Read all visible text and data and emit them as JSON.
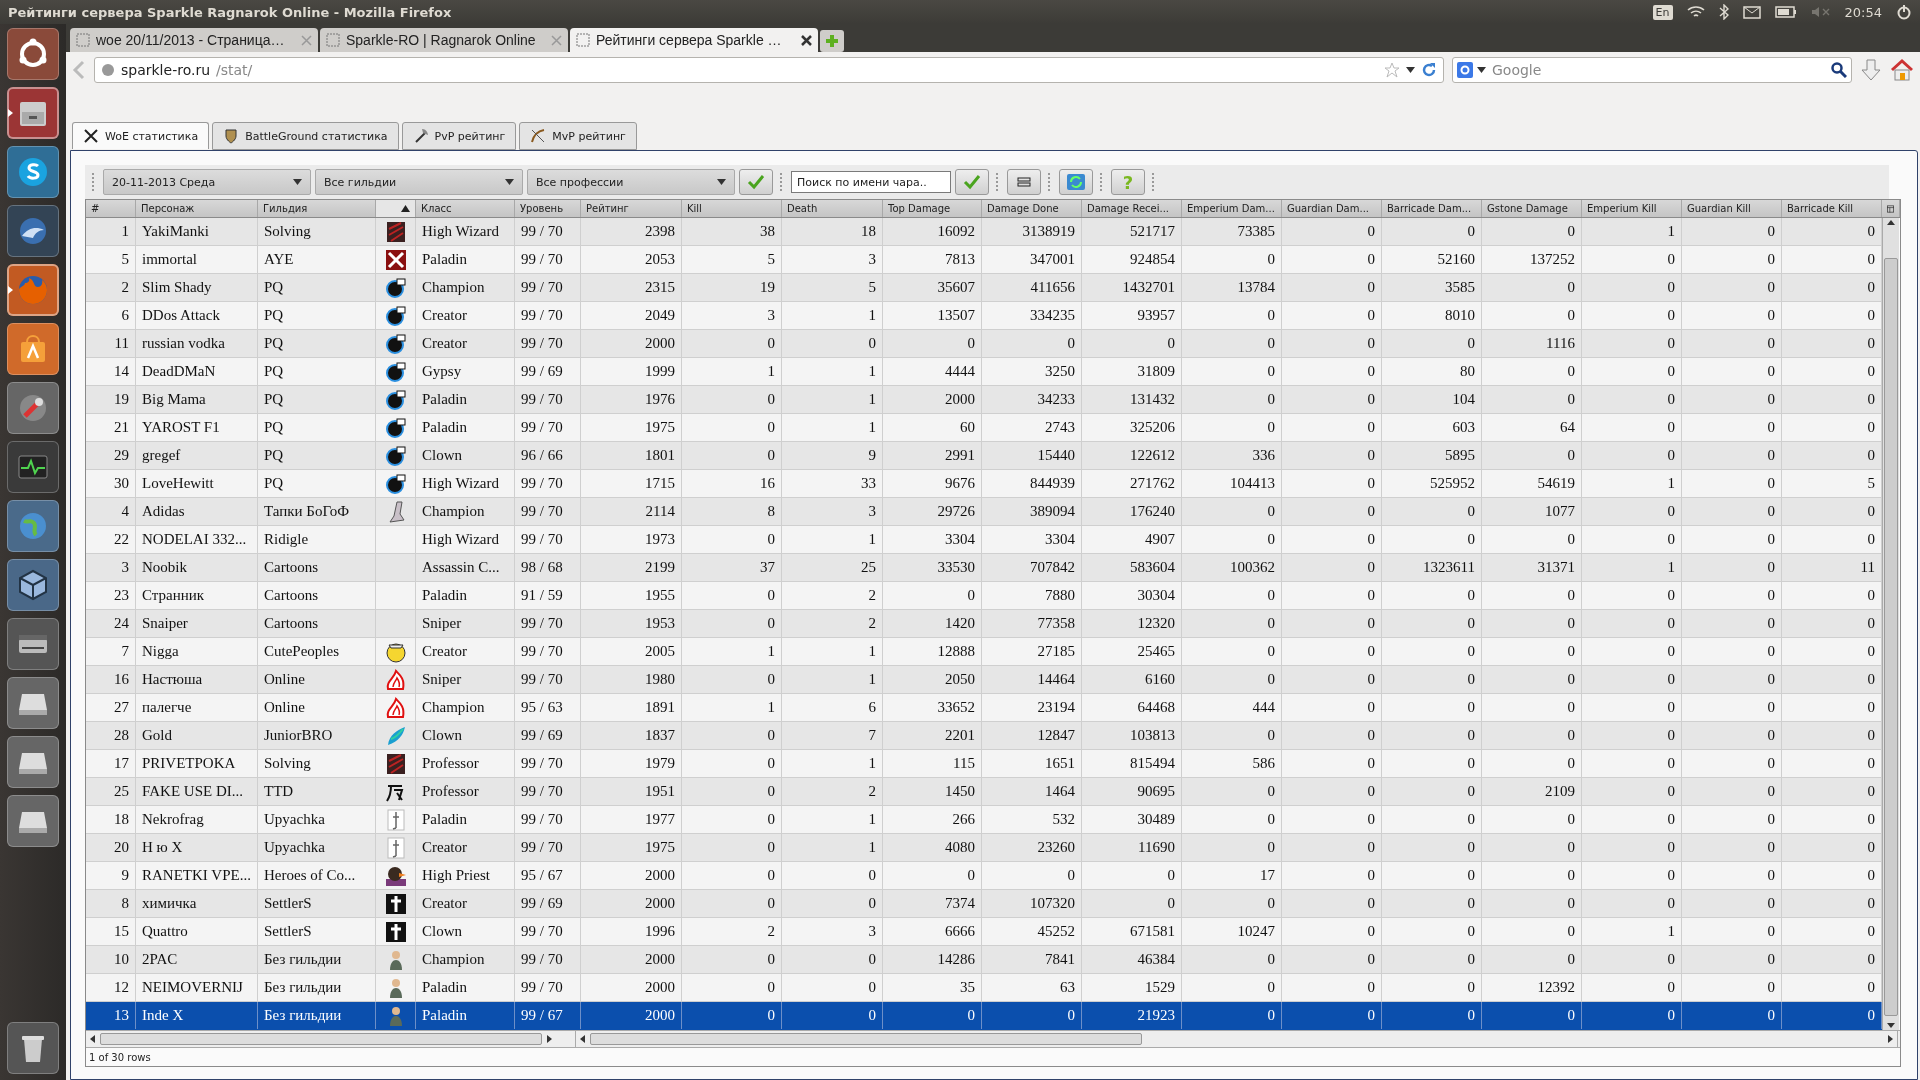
{
  "top_panel": {
    "title": "Рейтинги сервера Sparkle Ragnarok Online - Mozilla Firefox",
    "keyboard": "En",
    "clock": "20:54"
  },
  "launcher": [
    {
      "kind": "dash",
      "running": false
    },
    {
      "kind": "files",
      "running": true
    },
    {
      "kind": "skype",
      "running": false
    },
    {
      "kind": "mail",
      "running": false
    },
    {
      "kind": "firefox",
      "running": true
    },
    {
      "kind": "store",
      "running": false
    },
    {
      "kind": "tools",
      "running": false
    },
    {
      "kind": "monitor",
      "running": false
    },
    {
      "kind": "globe",
      "running": false
    },
    {
      "kind": "cube",
      "running": false
    },
    {
      "kind": "scanner",
      "running": false
    },
    {
      "kind": "disk",
      "running": false
    },
    {
      "kind": "disk",
      "running": false
    },
    {
      "kind": "disk",
      "running": false
    },
    {
      "kind": "trash",
      "running": false
    }
  ],
  "browser_tabs": [
    {
      "title": "woe 20/11/2013 - Страница…",
      "selected": false
    },
    {
      "title": "Sparkle-RO | Ragnarok Online",
      "selected": false
    },
    {
      "title": "Рейтинги сервера Sparkle …",
      "selected": true
    }
  ],
  "address_bar": {
    "host": "sparkle-ro.ru",
    "path": "/stat/"
  },
  "search_bar": {
    "placeholder": "Google"
  },
  "page_tabs": [
    {
      "label": "WoE статистика",
      "selected": true,
      "kind": "swords"
    },
    {
      "label": "BattleGround статистика",
      "selected": false,
      "kind": "shield"
    },
    {
      "label": "PvP рейтинг",
      "selected": false,
      "kind": "axe"
    },
    {
      "label": "MvP рейтинг",
      "selected": false,
      "kind": "bow"
    }
  ],
  "toolbar": {
    "date": "20-11-2013 Среда",
    "guild": "Все гильдии",
    "class": "Все профессии",
    "search_placeholder": "Поиск по имени чара..",
    "help": "?"
  },
  "table": {
    "columns": [
      {
        "label": "#",
        "sorted": false
      },
      {
        "label": "Персонаж",
        "sorted": false
      },
      {
        "label": "Гильдия",
        "sorted": false
      },
      {
        "sorted": true
      },
      {
        "label": "Класс",
        "sorted": false
      },
      {
        "label": "Уровень",
        "sorted": false
      },
      {
        "label": "Рейтинг",
        "sorted": false
      },
      {
        "label": "Kill",
        "sorted": false
      },
      {
        "label": "Death",
        "sorted": false
      },
      {
        "label": "Top Damage",
        "sorted": false
      },
      {
        "label": "Damage Done",
        "sorted": false
      },
      {
        "label": "Damage Recei...",
        "sorted": false
      },
      {
        "label": "Emperium Dam...",
        "sorted": false
      },
      {
        "label": "Guardian Dam...",
        "sorted": false
      },
      {
        "label": "Barricade Dam...",
        "sorted": false
      },
      {
        "label": "Gstone Damage",
        "sorted": false
      },
      {
        "label": "Emperium Kill",
        "sorted": false
      },
      {
        "label": "Guardian Kill",
        "sorted": false
      },
      {
        "label": "Barricade Kill",
        "sorted": false
      }
    ],
    "rows": [
      {
        "kind": "solving",
        "selected": false,
        "cells": [
          "1",
          "YakiManki",
          "Solving",
          "",
          "High Wizard",
          "99 / 70",
          "2398",
          "38",
          "18",
          "16092",
          "3138919",
          "521717",
          "73385",
          "0",
          "0",
          "0",
          "1",
          "0",
          "0"
        ]
      },
      {
        "kind": "aye",
        "selected": false,
        "cells": [
          "5",
          "immortal",
          "AYE",
          "",
          "Paladin",
          "99 / 70",
          "2053",
          "5",
          "3",
          "7813",
          "347001",
          "924854",
          "0",
          "0",
          "52160",
          "137252",
          "0",
          "0",
          "0"
        ]
      },
      {
        "kind": "pq",
        "selected": false,
        "cells": [
          "2",
          "Slim Shady",
          "PQ",
          "",
          "Champion",
          "99 / 70",
          "2315",
          "19",
          "5",
          "35607",
          "411656",
          "1432701",
          "13784",
          "0",
          "3585",
          "0",
          "0",
          "0",
          "0"
        ]
      },
      {
        "kind": "pq",
        "selected": false,
        "cells": [
          "6",
          "DDos Attack",
          "PQ",
          "",
          "Creator",
          "99 / 70",
          "2049",
          "3",
          "1",
          "13507",
          "334235",
          "93957",
          "0",
          "0",
          "8010",
          "0",
          "0",
          "0",
          "0"
        ]
      },
      {
        "kind": "pq",
        "selected": false,
        "cells": [
          "11",
          "russian vodka",
          "PQ",
          "",
          "Creator",
          "99 / 70",
          "2000",
          "0",
          "0",
          "0",
          "0",
          "0",
          "0",
          "0",
          "0",
          "1116",
          "0",
          "0",
          "0"
        ]
      },
      {
        "kind": "pq",
        "selected": false,
        "cells": [
          "14",
          "DeadDMaN",
          "PQ",
          "",
          "Gypsy",
          "99 / 69",
          "1999",
          "1",
          "1",
          "4444",
          "3250",
          "31809",
          "0",
          "0",
          "80",
          "0",
          "0",
          "0",
          "0"
        ]
      },
      {
        "kind": "pq",
        "selected": false,
        "cells": [
          "19",
          "Big Mama",
          "PQ",
          "",
          "Paladin",
          "99 / 70",
          "1976",
          "0",
          "1",
          "2000",
          "34233",
          "131432",
          "0",
          "0",
          "104",
          "0",
          "0",
          "0",
          "0"
        ]
      },
      {
        "kind": "pq",
        "selected": false,
        "cells": [
          "21",
          "YAROST F1",
          "PQ",
          "",
          "Paladin",
          "99 / 70",
          "1975",
          "0",
          "1",
          "60",
          "2743",
          "325206",
          "0",
          "0",
          "603",
          "64",
          "0",
          "0",
          "0"
        ]
      },
      {
        "kind": "pq",
        "selected": false,
        "cells": [
          "29",
          "gregef",
          "PQ",
          "",
          "Clown",
          "96 / 66",
          "1801",
          "0",
          "9",
          "2991",
          "15440",
          "122612",
          "336",
          "0",
          "5895",
          "0",
          "0",
          "0",
          "0"
        ]
      },
      {
        "kind": "pq",
        "selected": false,
        "cells": [
          "30",
          "LoveHewitt",
          "PQ",
          "",
          "High Wizard",
          "99 / 70",
          "1715",
          "16",
          "33",
          "9676",
          "844939",
          "271762",
          "104413",
          "0",
          "525952",
          "54619",
          "1",
          "0",
          "5"
        ]
      },
      {
        "kind": "boot",
        "selected": false,
        "cells": [
          "4",
          "Adidas",
          "Тапки БоГоФ",
          "",
          "Champion",
          "99 / 70",
          "2114",
          "8",
          "3",
          "29726",
          "389094",
          "176240",
          "0",
          "0",
          "0",
          "1077",
          "0",
          "0",
          "0"
        ]
      },
      {
        "kind": "none",
        "selected": false,
        "cells": [
          "22",
          "NODELAI 332...",
          "Ridigle",
          "",
          "High Wizard",
          "99 / 70",
          "1973",
          "0",
          "1",
          "3304",
          "3304",
          "4907",
          "0",
          "0",
          "0",
          "0",
          "0",
          "0",
          "0"
        ]
      },
      {
        "kind": "none",
        "selected": false,
        "cells": [
          "3",
          "Noobik",
          "Cartoons",
          "",
          "Assassin C...",
          "98 / 68",
          "2199",
          "37",
          "25",
          "33530",
          "707842",
          "583604",
          "100362",
          "0",
          "1323611",
          "31371",
          "1",
          "0",
          "11"
        ]
      },
      {
        "kind": "none",
        "selected": false,
        "cells": [
          "23",
          "Странник",
          "Cartoons",
          "",
          "Paladin",
          "91 / 59",
          "1955",
          "0",
          "2",
          "0",
          "7880",
          "30304",
          "0",
          "0",
          "0",
          "0",
          "0",
          "0",
          "0"
        ]
      },
      {
        "kind": "none",
        "selected": false,
        "cells": [
          "24",
          "Snaiper",
          "Cartoons",
          "",
          "Sniper",
          "99 / 70",
          "1953",
          "0",
          "2",
          "1420",
          "77358",
          "12320",
          "0",
          "0",
          "0",
          "0",
          "0",
          "0",
          "0"
        ]
      },
      {
        "kind": "chick",
        "selected": false,
        "cells": [
          "7",
          "Nigga",
          "CutePeoples",
          "",
          "Creator",
          "99 / 70",
          "2005",
          "1",
          "1",
          "12888",
          "27185",
          "25465",
          "0",
          "0",
          "0",
          "0",
          "0",
          "0",
          "0"
        ]
      },
      {
        "kind": "flame",
        "selected": false,
        "cells": [
          "16",
          "Настюша",
          "Online",
          "",
          "Sniper",
          "99 / 70",
          "1980",
          "0",
          "1",
          "2050",
          "14464",
          "6160",
          "0",
          "0",
          "0",
          "0",
          "0",
          "0",
          "0"
        ]
      },
      {
        "kind": "flame",
        "selected": false,
        "cells": [
          "27",
          "палегче",
          "Online",
          "",
          "Champion",
          "95 / 63",
          "1891",
          "1",
          "6",
          "33652",
          "23194",
          "64468",
          "444",
          "0",
          "0",
          "0",
          "0",
          "0",
          "0"
        ]
      },
      {
        "kind": "feather",
        "selected": false,
        "cells": [
          "28",
          "Gold",
          "JuniorBRO",
          "",
          "Clown",
          "99 / 69",
          "1837",
          "0",
          "7",
          "2201",
          "12847",
          "103813",
          "0",
          "0",
          "0",
          "0",
          "0",
          "0",
          "0"
        ]
      },
      {
        "kind": "solving",
        "selected": false,
        "cells": [
          "17",
          "PRIVETPOKA",
          "Solving",
          "",
          "Professor",
          "99 / 70",
          "1979",
          "0",
          "1",
          "115",
          "1651",
          "815494",
          "586",
          "0",
          "0",
          "0",
          "0",
          "0",
          "0"
        ]
      },
      {
        "kind": "brush",
        "selected": false,
        "cells": [
          "25",
          "FAKE USE DI...",
          "TTD",
          "",
          "Professor",
          "99 / 70",
          "1951",
          "0",
          "2",
          "1450",
          "1464",
          "90695",
          "0",
          "0",
          "0",
          "2109",
          "0",
          "0",
          "0"
        ]
      },
      {
        "kind": "stick",
        "selected": false,
        "cells": [
          "18",
          "Nekrofrag",
          "Upyachka",
          "",
          "Paladin",
          "99 / 70",
          "1977",
          "0",
          "1",
          "266",
          "532",
          "30489",
          "0",
          "0",
          "0",
          "0",
          "0",
          "0",
          "0"
        ]
      },
      {
        "kind": "stick",
        "selected": false,
        "cells": [
          "20",
          "Н ю Х",
          "Upyachka",
          "",
          "Creator",
          "99 / 70",
          "1975",
          "0",
          "1",
          "4080",
          "23260",
          "11690",
          "0",
          "0",
          "0",
          "0",
          "0",
          "0",
          "0"
        ]
      },
      {
        "kind": "duck",
        "selected": false,
        "cells": [
          "9",
          "RANETKI VPE...",
          "Heroes of Co...",
          "",
          "High Priest",
          "95 / 67",
          "2000",
          "0",
          "0",
          "0",
          "0",
          "0",
          "17",
          "0",
          "0",
          "0",
          "0",
          "0",
          "0"
        ]
      },
      {
        "kind": "cross",
        "selected": false,
        "cells": [
          "8",
          "химичка",
          "SettlerS",
          "",
          "Creator",
          "99 / 69",
          "2000",
          "0",
          "0",
          "7374",
          "107320",
          "0",
          "0",
          "0",
          "0",
          "0",
          "0",
          "0",
          "0"
        ]
      },
      {
        "kind": "cross",
        "selected": false,
        "cells": [
          "15",
          "Quattro",
          "SettlerS",
          "",
          "Clown",
          "99 / 70",
          "1996",
          "2",
          "3",
          "6666",
          "45252",
          "671581",
          "10247",
          "0",
          "0",
          "0",
          "1",
          "0",
          "0"
        ]
      },
      {
        "kind": "person",
        "selected": false,
        "cells": [
          "10",
          "2PAC",
          "Без гильдии",
          "",
          "Champion",
          "99 / 70",
          "2000",
          "0",
          "0",
          "14286",
          "7841",
          "46384",
          "0",
          "0",
          "0",
          "0",
          "0",
          "0",
          "0"
        ]
      },
      {
        "kind": "person",
        "selected": false,
        "cells": [
          "12",
          "NEIMOVERNIJ",
          "Без гильдии",
          "",
          "Paladin",
          "99 / 70",
          "2000",
          "0",
          "0",
          "35",
          "63",
          "1529",
          "0",
          "0",
          "0",
          "12392",
          "0",
          "0",
          "0"
        ]
      },
      {
        "kind": "person",
        "selected": true,
        "cells": [
          "13",
          "Inde X",
          "Без гильдии",
          "",
          "Paladin",
          "99 / 67",
          "2000",
          "0",
          "0",
          "0",
          "0",
          "21923",
          "0",
          "0",
          "0",
          "0",
          "0",
          "0",
          "0"
        ]
      }
    ]
  },
  "status": "1 of 30 rows"
}
